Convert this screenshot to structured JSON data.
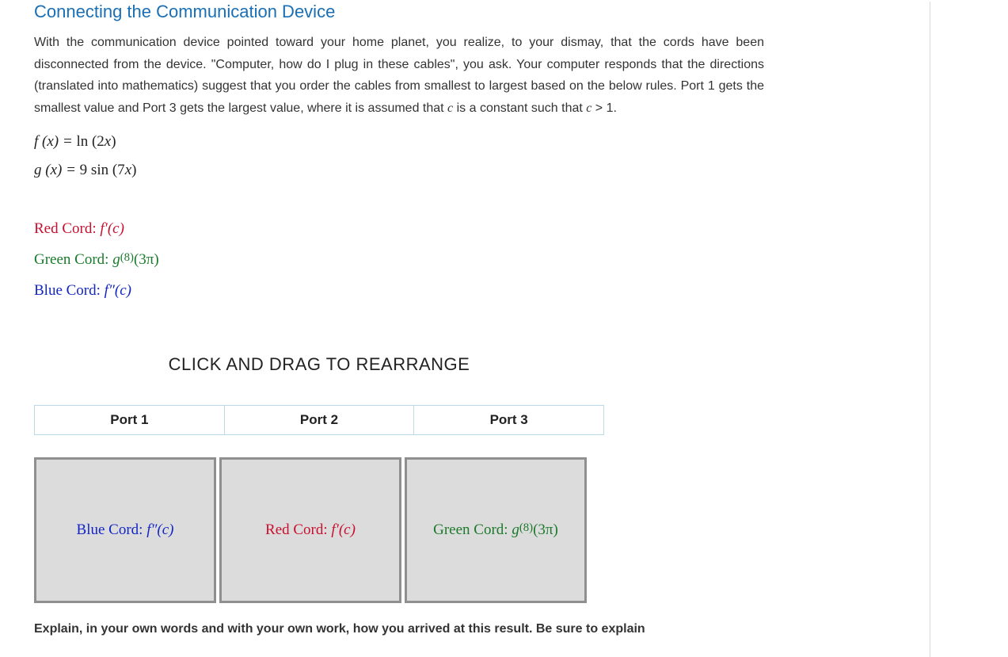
{
  "title": "Connecting the Communication Device",
  "instructions_pre": "With the communication device pointed toward your home planet, you realize, to your dismay, that the cords have been disconnected from the device. \"Computer, how do I plug in these cables\", you ask. Your computer responds that the directions (translated into mathematics) suggest that you order the cables from smallest to largest based on the below rules. Port 1 gets the smallest value and Port 3 gets the largest value, where it is assumed that ",
  "instructions_c1": "c",
  "instructions_mid": " is a constant such that ",
  "instructions_c2": "c",
  "instructions_gt": " > 1.",
  "fns": {
    "f_lhs": "f (x) = ",
    "f_rhs": "ln (2x)",
    "g_lhs": "g (x) = ",
    "g_rhs": "9 sin (7x)"
  },
  "cords": {
    "red_label": "Red Cord: ",
    "red_expr_a": "f",
    "red_expr_b": "′(c)",
    "green_label": "Green Cord: ",
    "green_expr_a": "g",
    "green_sup": "(8)",
    "green_expr_b": "(3π)",
    "blue_label": "Blue Cord: ",
    "blue_expr_a": "f",
    "blue_expr_b": "″(c)"
  },
  "drag_heading": "CLICK AND DRAG TO REARRANGE",
  "ports": [
    {
      "label": "Port 1"
    },
    {
      "label": "Port 2"
    },
    {
      "label": "Port 3"
    }
  ],
  "cards": [
    {
      "color": "blue",
      "label": "Blue Cord: ",
      "expr_a": "f",
      "expr_b": "″(c)"
    },
    {
      "color": "red",
      "label": "Red Cord: ",
      "expr_a": "f",
      "expr_b": "′(c)"
    },
    {
      "color": "green",
      "label": "Green Cord: ",
      "expr_a": "g",
      "sup": "(8)",
      "expr_b": "(3π)"
    }
  ],
  "explain": "Explain, in your own words and with your own work, how you arrived at this result. Be sure to explain"
}
